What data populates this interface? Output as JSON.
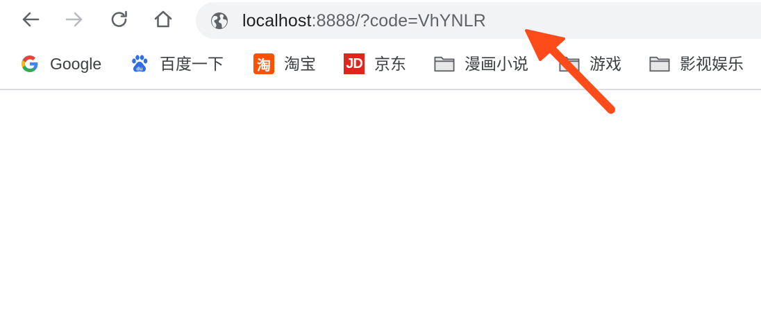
{
  "toolbar": {
    "back_icon": "arrow-left-icon",
    "forward_icon": "arrow-right-icon",
    "reload_icon": "reload-icon",
    "home_icon": "home-icon"
  },
  "omnibox": {
    "site_icon": "globe-icon",
    "url_host": "localhost",
    "url_rest": ":8888/?code=VhYNLR"
  },
  "bookmarks": [
    {
      "label": "Google",
      "icon": "google-icon"
    },
    {
      "label": "百度一下",
      "icon": "baidu-icon"
    },
    {
      "label": "淘宝",
      "icon": "taobao-icon",
      "glyph": "淘"
    },
    {
      "label": "京东",
      "icon": "jd-icon",
      "glyph": "JD"
    },
    {
      "label": "漫画小说",
      "icon": "folder-icon"
    },
    {
      "label": "游戏",
      "icon": "folder-icon"
    },
    {
      "label": "影视娱乐",
      "icon": "folder-icon"
    }
  ],
  "colors": {
    "arrow": "#fe4b1a",
    "omnibox_bg": "#f1f3f4",
    "jd_red": "#e1251b",
    "taobao_orange": "#ff5000"
  }
}
